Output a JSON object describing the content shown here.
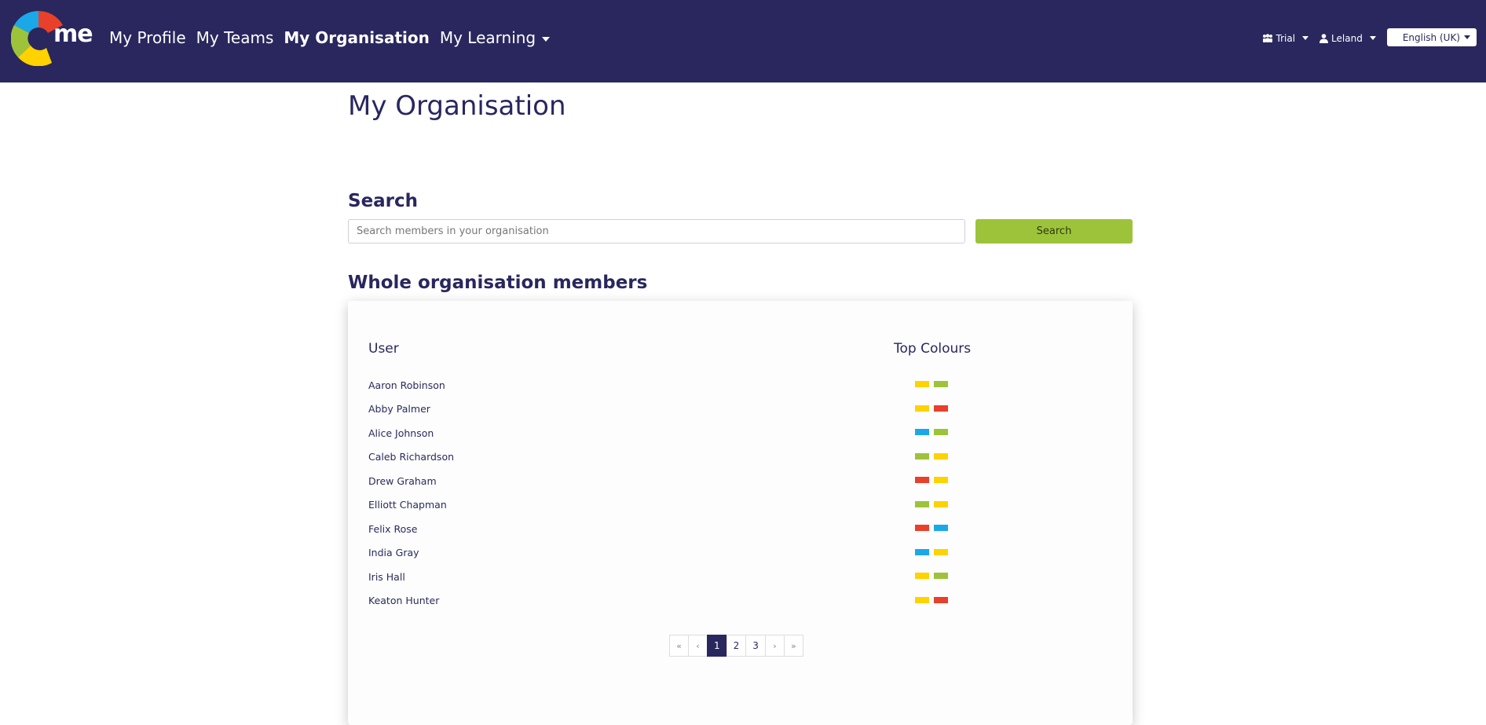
{
  "colors": {
    "nav_bg": "#29275e",
    "accent_green": "#9dc33b",
    "yellow": "#ffd200",
    "green": "#9dc33b",
    "red": "#e8402b",
    "blue": "#1aa8e8"
  },
  "nav": {
    "logo_text": "me",
    "links": [
      {
        "label": "My Profile"
      },
      {
        "label": "My Teams"
      },
      {
        "label": "My Organisation"
      },
      {
        "label": "My Learning"
      }
    ],
    "trial_label": "Trial",
    "user_label": "Leland",
    "language_label": "English (UK)"
  },
  "page": {
    "title": "My Organisation",
    "search_heading": "Search",
    "search_placeholder": "Search members in your organisation",
    "search_button": "Search",
    "members_heading": "Whole organisation members"
  },
  "table": {
    "col_user": "User",
    "col_colours": "Top Colours",
    "rows": [
      {
        "name": "Aaron Robinson",
        "colours": [
          "yellow",
          "green"
        ]
      },
      {
        "name": "Abby Palmer",
        "colours": [
          "yellow",
          "red"
        ]
      },
      {
        "name": "Alice Johnson",
        "colours": [
          "blue",
          "green"
        ]
      },
      {
        "name": "Caleb Richardson",
        "colours": [
          "green",
          "yellow"
        ]
      },
      {
        "name": "Drew Graham",
        "colours": [
          "red",
          "yellow"
        ]
      },
      {
        "name": "Elliott Chapman",
        "colours": [
          "green",
          "yellow"
        ]
      },
      {
        "name": "Felix Rose",
        "colours": [
          "red",
          "blue"
        ]
      },
      {
        "name": "India Gray",
        "colours": [
          "blue",
          "yellow"
        ]
      },
      {
        "name": "Iris Hall",
        "colours": [
          "yellow",
          "green"
        ]
      },
      {
        "name": "Keaton Hunter",
        "colours": [
          "yellow",
          "red"
        ]
      }
    ]
  },
  "pagination": {
    "first": "«",
    "prev": "‹",
    "pages": [
      "1",
      "2",
      "3"
    ],
    "current": "1",
    "next": "›",
    "last": "»"
  }
}
